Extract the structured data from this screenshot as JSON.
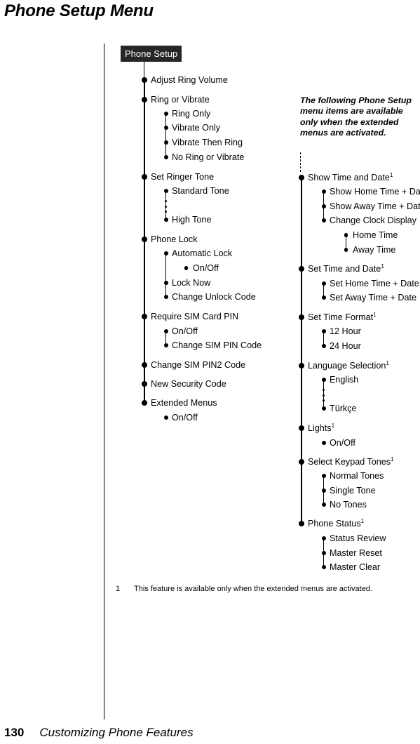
{
  "page": {
    "title": "Phone Setup Menu",
    "footer_number": "130",
    "footer_text": "Customizing Phone Features"
  },
  "chip": {
    "label": "Phone Setup"
  },
  "note": {
    "text": "The following Phone Setup menu items are available only when the extended menus are activated."
  },
  "footnote": {
    "marker": "1",
    "text": "This feature is available only when the extended menus are activated."
  },
  "left_column": [
    {
      "label": "Adjust Ring Volume",
      "level": 1
    },
    {
      "label": "Ring or Vibrate",
      "level": 1
    },
    {
      "label": "Ring Only",
      "level": 2
    },
    {
      "label": "Vibrate Only",
      "level": 2
    },
    {
      "label": "Vibrate Then Ring",
      "level": 2
    },
    {
      "label": "No Ring or Vibrate",
      "level": 2
    },
    {
      "label": "Set Ringer Tone",
      "level": 1
    },
    {
      "label": "Standard Tone",
      "level": 2
    },
    {
      "label": "High Tone",
      "level": 2
    },
    {
      "label": "Phone Lock",
      "level": 1
    },
    {
      "label": "Automatic Lock",
      "level": 2
    },
    {
      "label": "On/Off",
      "level": 3
    },
    {
      "label": "Lock Now",
      "level": 2
    },
    {
      "label": "Change Unlock Code",
      "level": 2
    },
    {
      "label": "Require SIM Card PIN",
      "level": 1
    },
    {
      "label": "On/Off",
      "level": 2
    },
    {
      "label": "Change SIM PIN Code",
      "level": 2
    },
    {
      "label": "Change SIM PIN2 Code",
      "level": 1
    },
    {
      "label": "New Security Code",
      "level": 1
    },
    {
      "label": "Extended Menus",
      "level": 1
    },
    {
      "label": "On/Off",
      "level": 2
    }
  ],
  "right_column": [
    {
      "label": "Show Time and Date",
      "level": 1,
      "footnote": "1"
    },
    {
      "label": "Show Home Time + Date",
      "level": 2
    },
    {
      "label": "Show Away Time + Date",
      "level": 2
    },
    {
      "label": "Change Clock Display",
      "level": 2
    },
    {
      "label": "Home Time",
      "level": 3
    },
    {
      "label": "Away Time",
      "level": 3
    },
    {
      "label": "Set Time and Date",
      "level": 1,
      "footnote": "1"
    },
    {
      "label": "Set Home Time + Date",
      "level": 2
    },
    {
      "label": "Set Away Time + Date",
      "level": 2
    },
    {
      "label": "Set Time Format",
      "level": 1,
      "footnote": "1"
    },
    {
      "label": "12 Hour",
      "level": 2
    },
    {
      "label": "24 Hour",
      "level": 2
    },
    {
      "label": "Language Selection",
      "level": 1,
      "footnote": "1"
    },
    {
      "label": "English",
      "level": 2
    },
    {
      "label": "Türkçe",
      "level": 2
    },
    {
      "label": "Lights",
      "level": 1,
      "footnote": "1"
    },
    {
      "label": "On/Off",
      "level": 2
    },
    {
      "label": "Select Keypad Tones",
      "level": 1,
      "footnote": "1"
    },
    {
      "label": "Normal Tones",
      "level": 2
    },
    {
      "label": "Single Tone",
      "level": 2
    },
    {
      "label": "No Tones",
      "level": 2
    },
    {
      "label": "Phone Status",
      "level": 1,
      "footnote": "1"
    },
    {
      "label": "Status Review",
      "level": 2
    },
    {
      "label": "Master Reset",
      "level": 2
    },
    {
      "label": "Master Clear",
      "level": 2
    }
  ]
}
